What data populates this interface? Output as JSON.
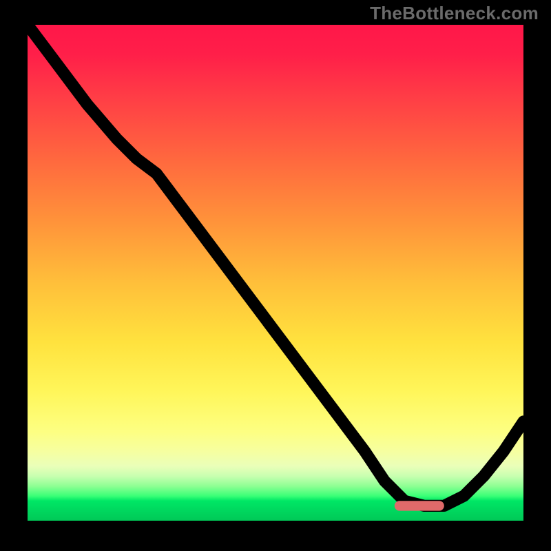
{
  "watermark": "TheBottleneck.com",
  "colors": {
    "gradient_top": "#ff1749",
    "gradient_mid": "#ffe23e",
    "gradient_bottom": "#00c957",
    "curve": "#000000",
    "marker": "#e06a6a",
    "background": "#000000"
  },
  "chart_data": {
    "type": "line",
    "title": "",
    "xlabel": "",
    "ylabel": "",
    "xlim": [
      0,
      100
    ],
    "ylim": [
      0,
      100
    ],
    "grid": false,
    "legend": false,
    "series": [
      {
        "name": "bottleneck-curve",
        "x": [
          0,
          6,
          12,
          18,
          22,
          26,
          32,
          38,
          44,
          50,
          56,
          62,
          68,
          72,
          76,
          80,
          84,
          88,
          92,
          96,
          100
        ],
        "y": [
          100,
          92,
          84,
          77,
          73,
          70,
          62,
          54,
          46,
          38,
          30,
          22,
          14,
          8,
          4,
          3,
          3,
          5,
          9,
          14,
          20
        ]
      }
    ],
    "annotations": [
      {
        "name": "optimal-marker",
        "shape": "rounded-bar",
        "x_start": 74,
        "x_end": 84,
        "y": 3
      }
    ],
    "notes": "y is mismatch percentage (higher = worse / red). Curve descends steeply from top-left, bottoms out near x≈78–82 at y≈3, then rises again toward the right edge. Values estimated from pixel positions against the 0–100 gradient scale."
  }
}
